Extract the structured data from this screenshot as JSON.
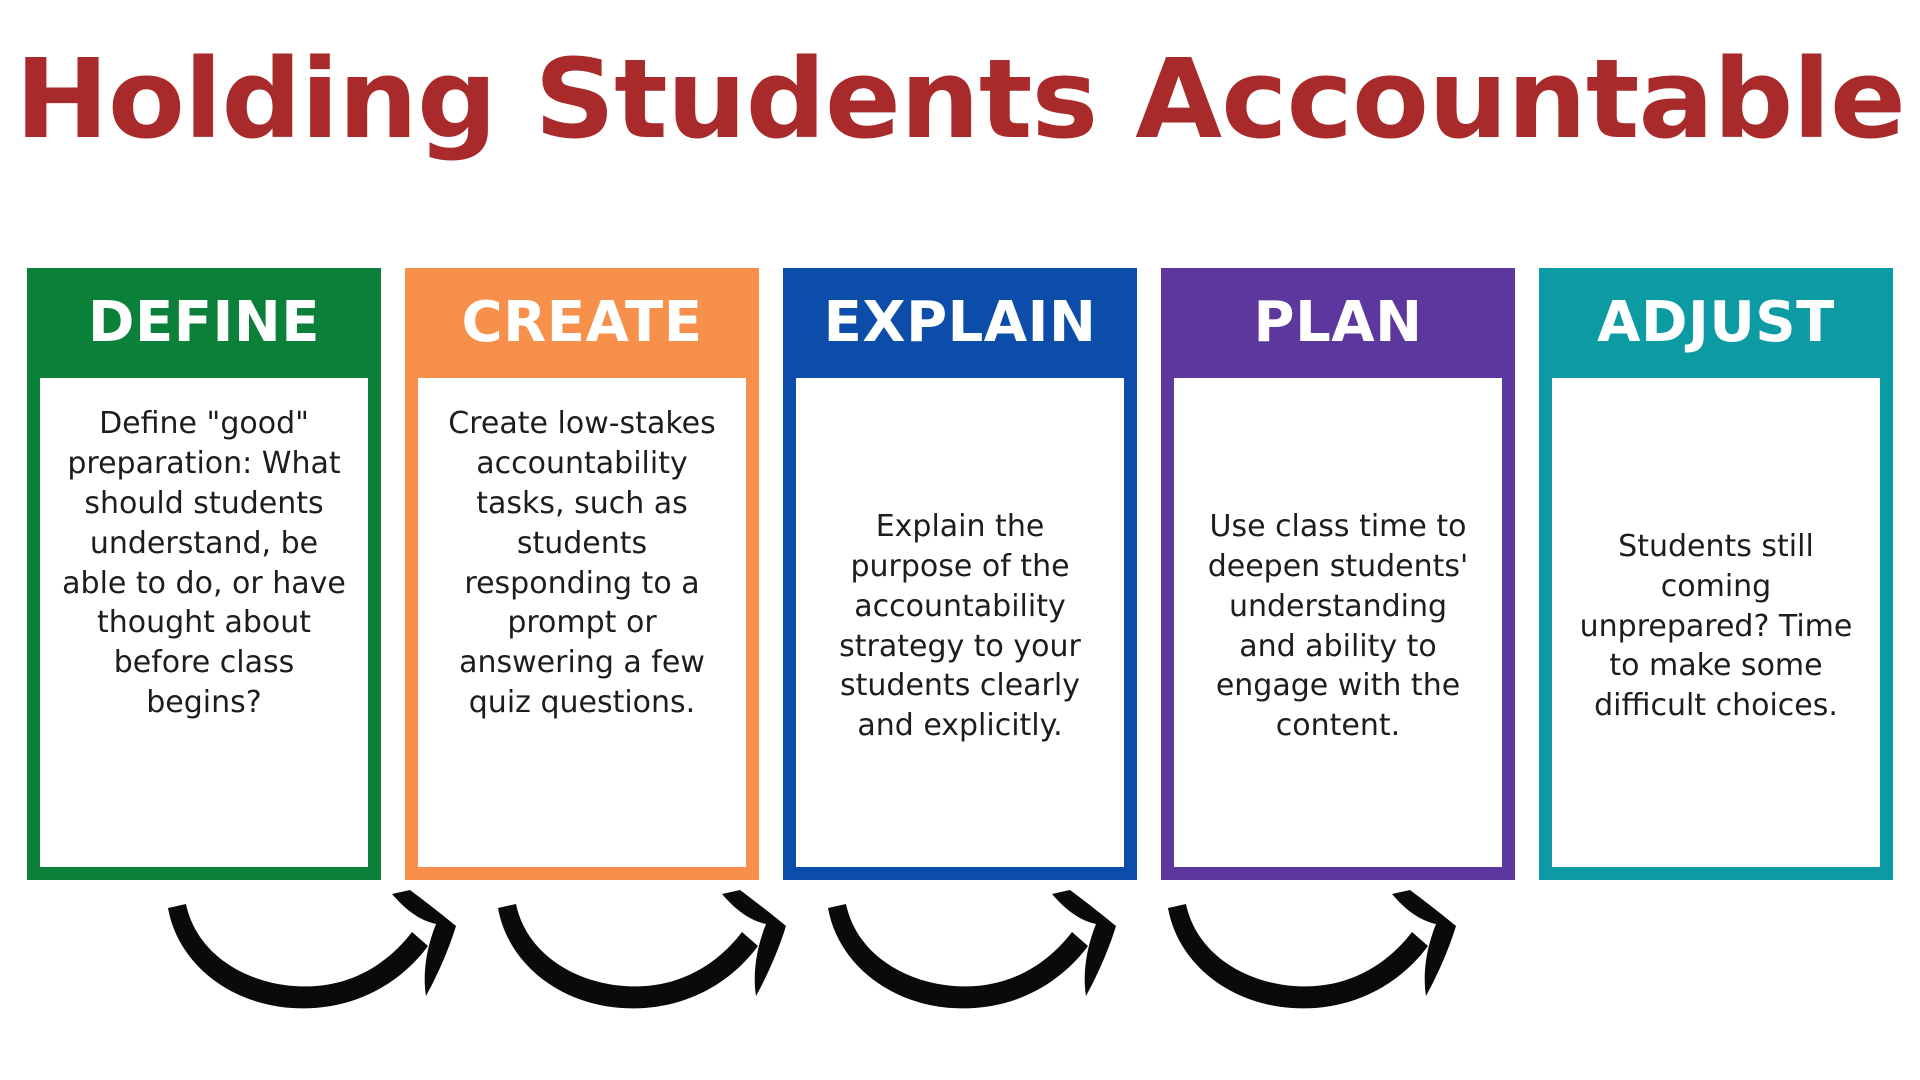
{
  "page": {
    "title": "Holding Students Accountable",
    "title_color": "#A92A2A",
    "background_color": "#FFFFFF"
  },
  "steps": [
    {
      "label": "DEFINE",
      "color": "#0A8038",
      "body": "Define \"good\" preparation: What should students understand, be able to do, or have thought about before class begins?"
    },
    {
      "label": "CREATE",
      "color": "#F7904B",
      "body": "Create low-stakes accountability tasks, such as students responding to a prompt or answering a few quiz questions."
    },
    {
      "label": "EXPLAIN",
      "color": "#0B4DA8",
      "body": "Explain the purpose of the accountability strategy to your students clearly and explicitly."
    },
    {
      "label": "PLAN",
      "color": "#5C379E",
      "body": "Use class time to deepen students' understanding and ability to engage with the content."
    },
    {
      "label": "ADJUST",
      "color": "#0D9BA3",
      "body": "Students still coming unprepared? Time to make some difficult choices."
    }
  ],
  "connectors": {
    "icon": "curved-arrow-right-icon",
    "color": "#0A0A0A",
    "count": 4
  }
}
